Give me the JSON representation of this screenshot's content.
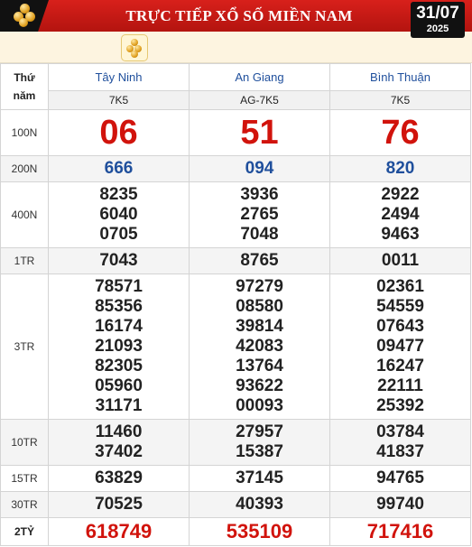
{
  "header": {
    "title": "TRỰC TIẾP XỔ SỐ MIỀN NAM",
    "date": "31/07",
    "year": "2025"
  },
  "table": {
    "corner_label": "Thứ\nnăm",
    "provinces": [
      "Tây Ninh",
      "An Giang",
      "Bình Thuận"
    ],
    "codes": [
      "7K5",
      "AG-7K5",
      "7K5"
    ],
    "prizes": [
      {
        "label": "100N",
        "values": [
          [
            "06"
          ],
          [
            "51"
          ],
          [
            "76"
          ]
        ]
      },
      {
        "label": "200N",
        "values": [
          [
            "666"
          ],
          [
            "094"
          ],
          [
            "820"
          ]
        ]
      },
      {
        "label": "400N",
        "values": [
          [
            "8235",
            "6040",
            "0705"
          ],
          [
            "3936",
            "2765",
            "7048"
          ],
          [
            "2922",
            "2494",
            "9463"
          ]
        ]
      },
      {
        "label": "1TR",
        "values": [
          [
            "7043"
          ],
          [
            "8765"
          ],
          [
            "0011"
          ]
        ]
      },
      {
        "label": "3TR",
        "values": [
          [
            "78571",
            "85356",
            "16174",
            "21093",
            "82305",
            "05960",
            "31171"
          ],
          [
            "97279",
            "08580",
            "39814",
            "42083",
            "13764",
            "93622",
            "00093"
          ],
          [
            "02361",
            "54559",
            "07643",
            "09477",
            "16247",
            "22111",
            "25392"
          ]
        ]
      },
      {
        "label": "10TR",
        "values": [
          [
            "11460",
            "37402"
          ],
          [
            "27957",
            "15387"
          ],
          [
            "03784",
            "41837"
          ]
        ]
      },
      {
        "label": "15TR",
        "values": [
          [
            "63829"
          ],
          [
            "37145"
          ],
          [
            "94765"
          ]
        ]
      },
      {
        "label": "30TR",
        "values": [
          [
            "70525"
          ],
          [
            "40393"
          ],
          [
            "99740"
          ]
        ]
      },
      {
        "label": "2TỶ",
        "values": [
          [
            "618749"
          ],
          [
            "535109"
          ],
          [
            "717416"
          ]
        ]
      }
    ]
  },
  "colors": {
    "header_red": "#c8170f",
    "prize_red": "#d1130c",
    "prize_blue": "#1f4f9c"
  },
  "icons": {
    "logo": "lottery-balls-icon",
    "subbar_button": "lottery-balls-icon"
  }
}
